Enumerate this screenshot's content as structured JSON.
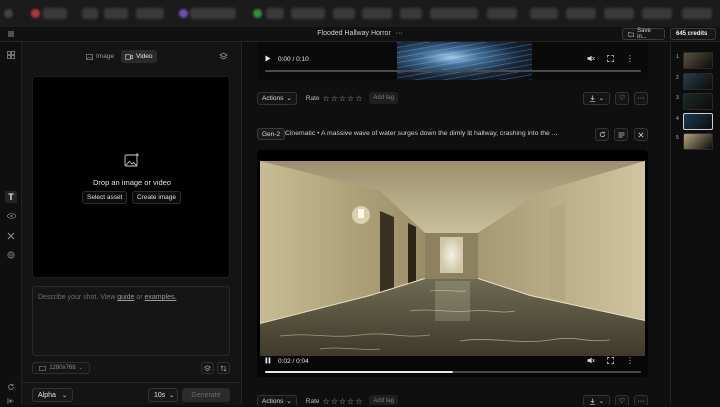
{
  "header": {
    "menu_icon": "menu-icon",
    "project_title": "Flooded Hallway Horror",
    "more_icon": "ellipsis-icon",
    "save_label": "Save in...",
    "credits": "645 credits"
  },
  "rail": {
    "icons": [
      "layout-icon",
      "text-icon",
      "eye-icon",
      "tools-icon",
      "globe-icon",
      "refresh-icon",
      "collapse-icon"
    ]
  },
  "left_panel": {
    "tabs": [
      {
        "label": "Image",
        "icon": "image-icon"
      },
      {
        "label": "Video",
        "icon": "video-icon"
      }
    ],
    "settings_icon": "stack-icon",
    "dropzone": {
      "icon": "image-plus-icon",
      "title": "Drop an image or video",
      "select_label": "Select asset",
      "create_label": "Create image"
    },
    "prompt": {
      "pre": "Describe your shot. View ",
      "guide": "guide",
      "mid": " or ",
      "examples": "examples."
    },
    "resolution": "1280x768",
    "model": "Alpha",
    "duration": "10s",
    "generate_label": "Generate"
  },
  "feed": {
    "top_video": {
      "time": "0:00 / 0:10"
    },
    "top_actions": {
      "actions_label": "Actions",
      "rate_label": "Rate",
      "add_tag_label": "Add tag"
    },
    "generation": {
      "badge": "Gen-2",
      "prompt": "Cinematic • A massive wave of water surges down the dimly lit hallway, crashing into the ...",
      "time": "0:02 / 0:04",
      "progress": 0.5
    },
    "bottom_actions": {
      "actions_label": "Actions",
      "rate_label": "Rate",
      "add_tag_label": "Add tag"
    }
  },
  "thumbnails": [
    {
      "num": "1",
      "color": "#5a5040"
    },
    {
      "num": "2",
      "color": "#2a3a48"
    },
    {
      "num": "3",
      "color": "#1d2a22"
    },
    {
      "num": "4",
      "color": "#1a3a55"
    },
    {
      "num": "5",
      "color": "#b2a480"
    }
  ]
}
